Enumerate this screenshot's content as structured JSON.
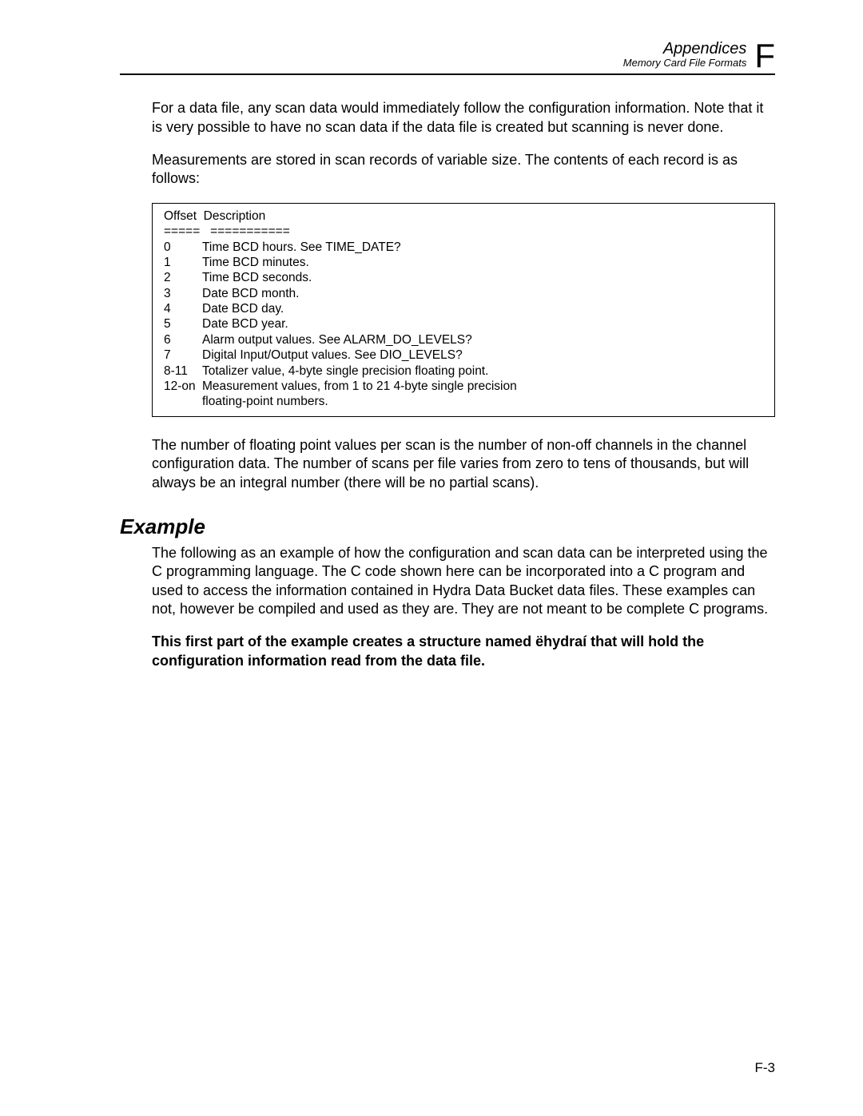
{
  "header": {
    "title": "Appendices",
    "subtitle": "Memory Card File Formats",
    "letter": "F"
  },
  "para1": "For a data file, any scan data would immediately follow the configuration information. Note that it is very possible to have no scan data if the data file is created but scanning is never done.",
  "para2": "Measurements are stored in scan records of variable size. The contents of each record is as follows:",
  "table": {
    "header": "Offset  Description",
    "divider": "=====   ===========",
    "rows": [
      {
        "offset": "0",
        "desc": "Time BCD hours.  See TIME_DATE?"
      },
      {
        "offset": "1",
        "desc": "Time BCD minutes."
      },
      {
        "offset": "2",
        "desc": "Time BCD seconds."
      },
      {
        "offset": "3",
        "desc": "Date BCD month."
      },
      {
        "offset": "4",
        "desc": "Date BCD day."
      },
      {
        "offset": "5",
        "desc": "Date BCD year."
      },
      {
        "offset": "6",
        "desc": "Alarm output values.  See ALARM_DO_LEVELS?"
      },
      {
        "offset": "7",
        "desc": "Digital Input/Output values.  See DIO_LEVELS?"
      },
      {
        "offset": "8-11",
        "desc": "Totalizer value, 4-byte single precision floating point."
      },
      {
        "offset": "12-on",
        "desc": "Measurement values, from 1 to 21 4-byte single precision"
      }
    ],
    "continuation": "floating-point numbers."
  },
  "para3": "The number of floating point values per scan is the number of non-off channels in the channel configuration data. The number of scans per file varies from zero to tens of thousands, but will always be an integral number (there will be no partial scans).",
  "example": {
    "heading": "Example",
    "para1": "The following as an example of how the configuration and scan data can be interpreted using the C programming language. The C code shown here can be incorporated into a C program and used to access the information contained in Hydra Data Bucket data files. These examples  can not, however be compiled and used as they are. They are not meant to be complete C programs.",
    "para2": "This first part of the example creates a structure named ëhydraí that will hold the configuration information read from the data file."
  },
  "pageNumber": "F-3"
}
